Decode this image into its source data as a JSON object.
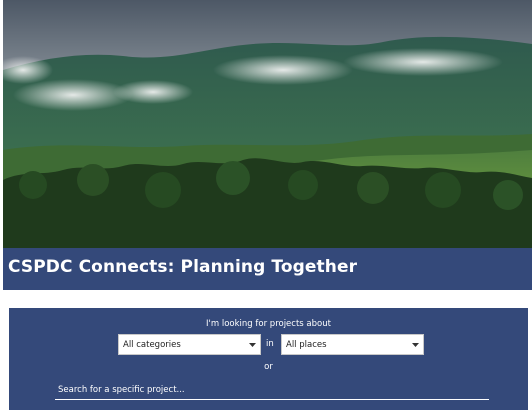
{
  "hero": {
    "image_description_icon": "mountain-landscape-image"
  },
  "header": {
    "title": "CSPDC Connects: Planning Together"
  },
  "search": {
    "prompt": "I'm looking for projects about",
    "category_select": {
      "value": "All categories"
    },
    "connector": "in",
    "place_select": {
      "value": "All places"
    },
    "or_label": "or",
    "input_placeholder": "Search for a specific project..."
  },
  "colors": {
    "brand_navy": "#34497a",
    "text_on_brand": "#ffffff"
  }
}
